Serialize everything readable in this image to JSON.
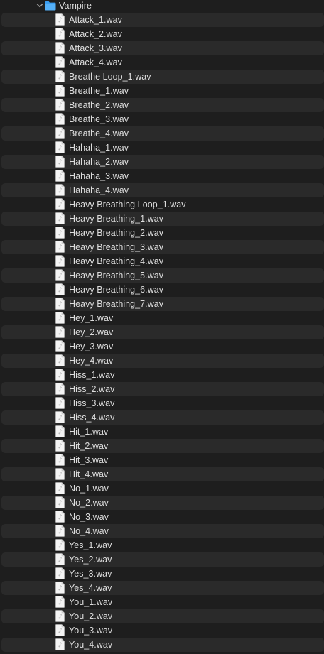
{
  "folder": {
    "name": "Vampire",
    "expanded": true,
    "icon": "folder-icon",
    "accent": "#3a9df0"
  },
  "files": [
    "Attack_1.wav",
    "Attack_2.wav",
    "Attack_3.wav",
    "Attack_4.wav",
    "Breathe Loop_1.wav",
    "Breathe_1.wav",
    "Breathe_2.wav",
    "Breathe_3.wav",
    "Breathe_4.wav",
    "Hahaha_1.wav",
    "Hahaha_2.wav",
    "Hahaha_3.wav",
    "Hahaha_4.wav",
    "Heavy Breathing Loop_1.wav",
    "Heavy Breathing_1.wav",
    "Heavy Breathing_2.wav",
    "Heavy Breathing_3.wav",
    "Heavy Breathing_4.wav",
    "Heavy Breathing_5.wav",
    "Heavy Breathing_6.wav",
    "Heavy Breathing_7.wav",
    "Hey_1.wav",
    "Hey_2.wav",
    "Hey_3.wav",
    "Hey_4.wav",
    "Hiss_1.wav",
    "Hiss_2.wav",
    "Hiss_3.wav",
    "Hiss_4.wav",
    "Hit_1.wav",
    "Hit_2.wav",
    "Hit_3.wav",
    "Hit_4.wav",
    "No_1.wav",
    "No_2.wav",
    "No_3.wav",
    "No_4.wav",
    "Yes_1.wav",
    "Yes_2.wav",
    "Yes_3.wav",
    "Yes_4.wav",
    "You_1.wav",
    "You_2.wav",
    "You_3.wav",
    "You_4.wav"
  ],
  "file_icon": "audio-file-icon",
  "colors": {
    "background": "#1e1e1e",
    "alt_row": "#2a2a2a",
    "text": "#dddddd"
  }
}
